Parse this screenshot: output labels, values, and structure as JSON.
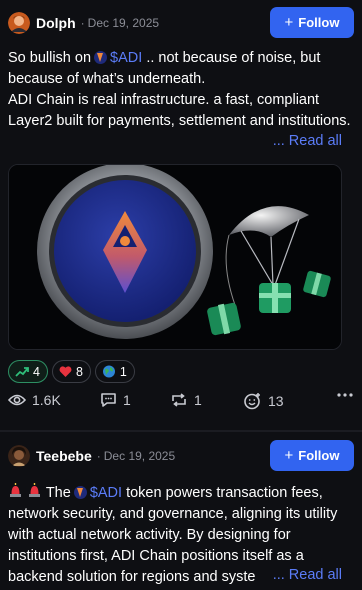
{
  "posts": [
    {
      "author": "Dolph",
      "date": "Dec 19, 2025",
      "follow_label": "Follow",
      "text_line1_before": "So bullish on",
      "token": "$ADI",
      "text_line1_after": ".. not because of noise, but because of what’s underneath.",
      "text_line2": "ADI Chain is real infrastructure. a fast, compliant Layer2 built for payments, settlement and institutions.",
      "ellipsis": "...",
      "read_all": "Read all",
      "reactions": [
        {
          "icon": "trending-up-icon",
          "count": "4",
          "active": true
        },
        {
          "icon": "heart-icon",
          "count": "8",
          "active": false
        },
        {
          "icon": "globe-emoji-icon",
          "count": "1",
          "active": false
        }
      ],
      "stats": {
        "views": "1.6K",
        "comments": "1",
        "reposts": "1",
        "likes": "13"
      }
    },
    {
      "author": "Teebebe",
      "date": "Dec 19, 2025",
      "follow_label": "Follow",
      "text_before": "The",
      "token": "$ADI",
      "text_after": "token powers transaction fees, network security, and governance, aligning its utility with actual network activity. By designing for institutions first, ADI Chain positions itself as a backend solution for regions and syste",
      "ellipsis": "...",
      "read_all": "Read all"
    }
  ],
  "colors": {
    "accent": "#3264f0",
    "link": "#5b7cf7",
    "background": "#0e0f13",
    "muted": "#8b8d96"
  }
}
